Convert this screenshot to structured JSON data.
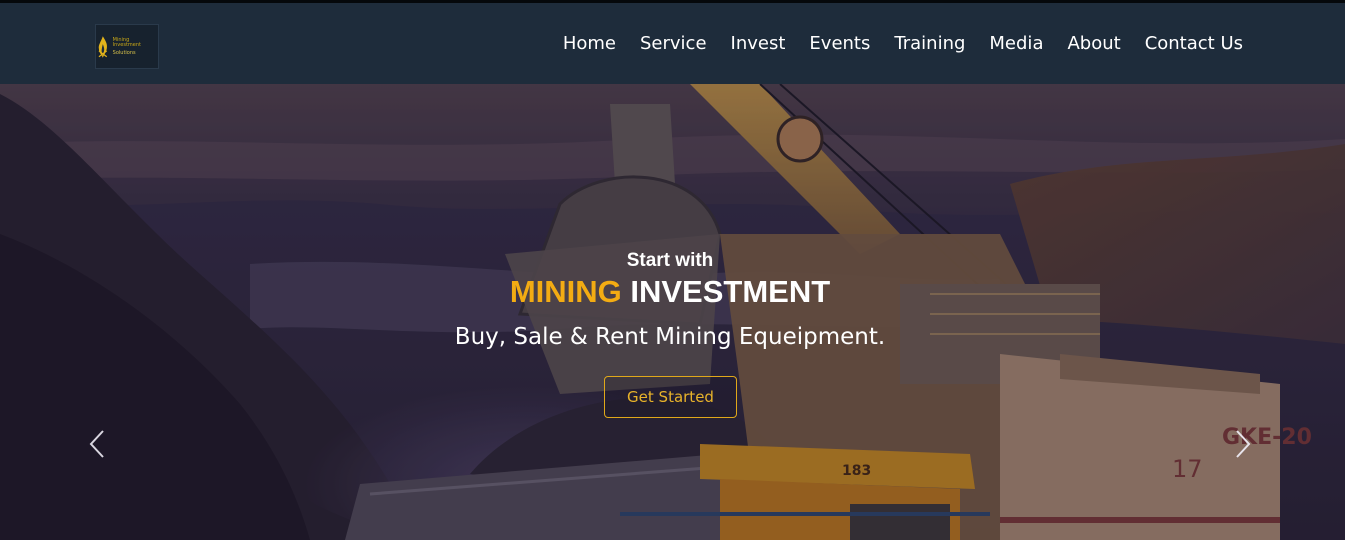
{
  "header": {
    "logo": {
      "name": "logo",
      "text_line1": "Mining Investment",
      "text_line2": "Solutions"
    },
    "nav": [
      "Home",
      "Service",
      "Invest",
      "Events",
      "Training",
      "Media",
      "About",
      "Contact Us"
    ]
  },
  "hero": {
    "eyebrow": "Start with",
    "headline_accent": "MINING",
    "headline_rest": " INVESTMENT",
    "subline": "Buy, Sale & Rent Mining Equeipment.",
    "cta_label": "Get Started",
    "prev_icon": "chevron-left-icon",
    "next_icon": "chevron-right-icon"
  },
  "colors": {
    "navbar_bg": "#1e2c3b",
    "accent": "#f3ac13",
    "button_border": "#e0a81a",
    "text": "#ffffff"
  }
}
